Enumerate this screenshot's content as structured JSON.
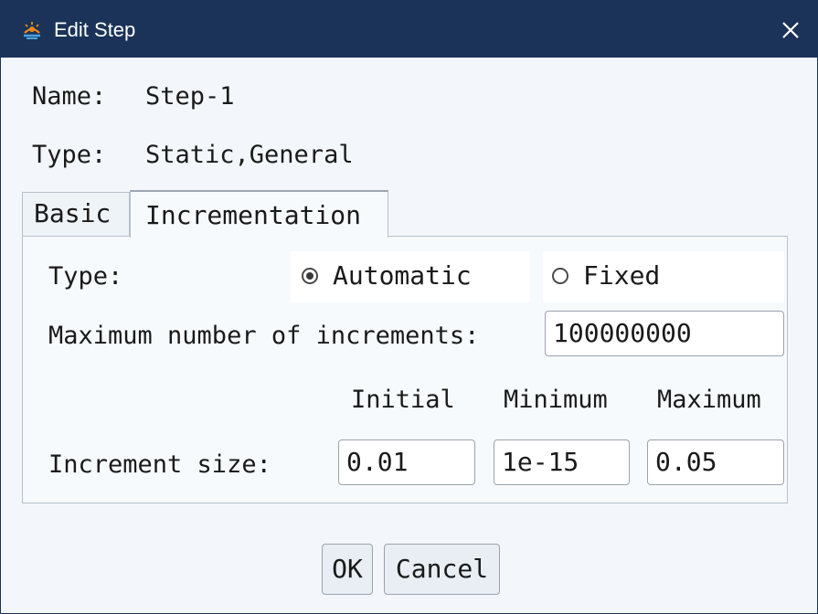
{
  "window": {
    "title": "Edit Step",
    "app_icon": "app-logo-icon",
    "close_icon": "close-icon"
  },
  "step": {
    "name_label": "Name:",
    "name_value": "Step-1",
    "type_label": "Type:",
    "type_value": "Static,General"
  },
  "tabs": [
    {
      "label": "Basic",
      "selected": false
    },
    {
      "label": "Incrementation",
      "selected": true
    }
  ],
  "incrementation": {
    "type_label": "Type:",
    "type_options": [
      {
        "label": "Automatic",
        "selected": true
      },
      {
        "label": "Fixed",
        "selected": false
      }
    ],
    "max_increments_label": "Maximum number of increments:",
    "max_increments_value": "100000000",
    "column_headers": [
      "Initial",
      "Minimum",
      "Maximum"
    ],
    "increment_size_label": "Increment size:",
    "increment_size": {
      "initial": "0.01",
      "minimum": "1e-15",
      "maximum": "0.05"
    }
  },
  "buttons": {
    "ok": "OK",
    "cancel": "Cancel"
  },
  "colors": {
    "titlebar": "#1b3358",
    "dialog_background": "#f3f7fb",
    "input_background": "#ffffff"
  }
}
